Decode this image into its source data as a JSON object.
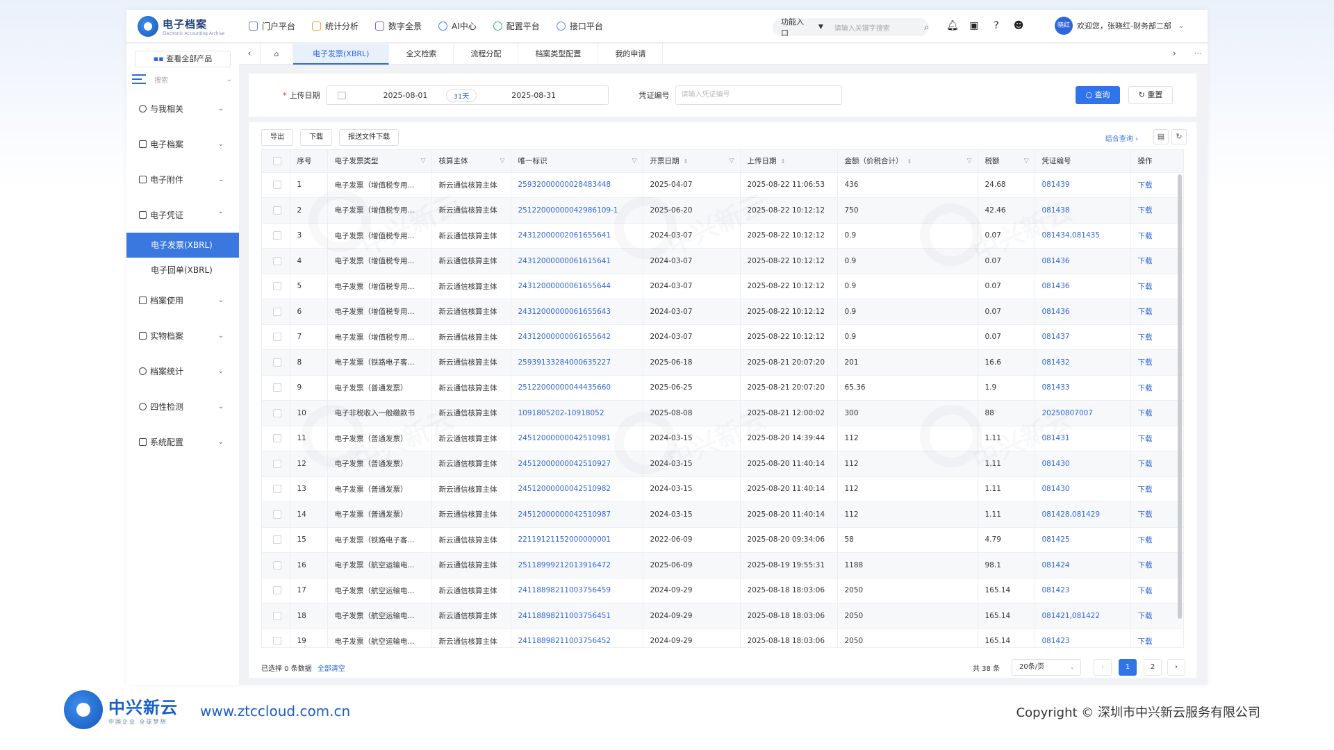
{
  "app": {
    "title": "电子档案",
    "subtitle": "Electronic Accounting Archive"
  },
  "nav": [
    "门户平台",
    "统计分析",
    "数字全景",
    "AI中心",
    "配置平台",
    "接口平台"
  ],
  "func": {
    "label": "功能入口",
    "placeholder": "请输入关键字搜索"
  },
  "user": {
    "avatar": "晓红",
    "welcome": "欢迎您，张晓红-财务部二部"
  },
  "sidebar": {
    "all_products": "查看全部产品",
    "search": "搜索",
    "items": [
      {
        "label": "与我相关"
      },
      {
        "label": "电子档案"
      },
      {
        "label": "电子附件"
      },
      {
        "label": "电子凭证"
      },
      {
        "label": "档案使用"
      },
      {
        "label": "实物档案"
      },
      {
        "label": "档案统计"
      },
      {
        "label": "四性检测"
      },
      {
        "label": "系统配置"
      }
    ],
    "subitems": [
      "电子发票(XBRL)",
      "电子回单(XBRL)"
    ]
  },
  "tabs": [
    "电子发票(XBRL)",
    "全文检索",
    "流程分配",
    "档案类型配置",
    "我的申请"
  ],
  "filter": {
    "upload_date_label": "上传日期",
    "required_mark": "*",
    "start_date": "2025-08-01",
    "days": "31天",
    "end_date": "2025-08-31",
    "voucher_label": "凭证编号",
    "voucher_placeholder": "请输入凭证编号",
    "query": "查询",
    "reset": "重置"
  },
  "toolbar": {
    "export": "导出",
    "download": "下载",
    "report_download": "报送文件下载",
    "combo_query": "结合查询"
  },
  "table": {
    "headers": [
      "序号",
      "电子发票类型",
      "核算主体",
      "唯一标识",
      "开票日期",
      "上传日期",
      "金额（价税合计）",
      "税额",
      "凭证编号",
      "操作"
    ],
    "rows": [
      [
        "1",
        "电子发票（增值税专用...",
        "新云通信核算主体",
        "25932000000028483448",
        "2025-04-07",
        "2025-08-22 11:06:53",
        "436",
        "24.68",
        "081439",
        "下载"
      ],
      [
        "2",
        "电子发票（增值税专用...",
        "新云通信核算主体",
        "25122000000042986109-1",
        "2025-06-20",
        "2025-08-22 10:12:12",
        "750",
        "42.46",
        "081438",
        "下载"
      ],
      [
        "3",
        "电子发票（增值税专用...",
        "新云通信核算主体",
        "24312000002061655641",
        "2024-03-07",
        "2025-08-22 10:12:12",
        "0.9",
        "0.07",
        "081434,081435",
        "下载"
      ],
      [
        "4",
        "电子发票（增值税专用...",
        "新云通信核算主体",
        "24312000000061615641",
        "2024-03-07",
        "2025-08-22 10:12:12",
        "0.9",
        "0.07",
        "081436",
        "下载"
      ],
      [
        "5",
        "电子发票（增值税专用...",
        "新云通信核算主体",
        "24312000000061655644",
        "2024-03-07",
        "2025-08-22 10:12:12",
        "0.9",
        "0.07",
        "081436",
        "下载"
      ],
      [
        "6",
        "电子发票（增值税专用...",
        "新云通信核算主体",
        "24312000000061655643",
        "2024-03-07",
        "2025-08-22 10:12:12",
        "0.9",
        "0.07",
        "081436",
        "下载"
      ],
      [
        "7",
        "电子发票（增值税专用...",
        "新云通信核算主体",
        "24312000000061655642",
        "2024-03-07",
        "2025-08-22 10:12:12",
        "0.9",
        "0.07",
        "081437",
        "下载"
      ],
      [
        "8",
        "电子发票（铁路电子客...",
        "新云通信核算主体",
        "25939133284000635227",
        "2025-06-18",
        "2025-08-21 20:07:20",
        "201",
        "16.6",
        "081432",
        "下载"
      ],
      [
        "9",
        "电子发票（普通发票）",
        "新云通信核算主体",
        "25122000000044435660",
        "2025-06-25",
        "2025-08-21 20:07:20",
        "65.36",
        "1.9",
        "081433",
        "下载"
      ],
      [
        "10",
        "电子非税收入一般缴款书",
        "新云通信核算主体",
        "1091805202-10918052",
        "2025-08-08",
        "2025-08-21 12:00:02",
        "300",
        "88",
        "20250807007",
        "下载"
      ],
      [
        "11",
        "电子发票（普通发票）",
        "新云通信核算主体",
        "24512000000042510981",
        "2024-03-15",
        "2025-08-20 14:39:44",
        "112",
        "1.11",
        "081431",
        "下载"
      ],
      [
        "12",
        "电子发票（普通发票）",
        "新云通信核算主体",
        "24512000000042510927",
        "2024-03-15",
        "2025-08-20 11:40:14",
        "112",
        "1.11",
        "081430",
        "下载"
      ],
      [
        "13",
        "电子发票（普通发票）",
        "新云通信核算主体",
        "24512000000042510982",
        "2024-03-15",
        "2025-08-20 11:40:14",
        "112",
        "1.11",
        "081430",
        "下载"
      ],
      [
        "14",
        "电子发票（普通发票）",
        "新云通信核算主体",
        "24512000000042510987",
        "2024-03-15",
        "2025-08-20 11:40:14",
        "112",
        "1.11",
        "081428,081429",
        "下载"
      ],
      [
        "15",
        "电子发票（铁路电子客...",
        "新云通信核算主体",
        "22119121152000000001",
        "2022-06-09",
        "2025-08-20 09:34:06",
        "58",
        "4.79",
        "081425",
        "下载"
      ],
      [
        "16",
        "电子发票（航空运输电...",
        "新云通信核算主体",
        "25118999212013916472",
        "2025-06-09",
        "2025-08-19 19:55:31",
        "1188",
        "98.1",
        "081424",
        "下载"
      ],
      [
        "17",
        "电子发票（航空运输电...",
        "新云通信核算主体",
        "24118898211003756459",
        "2024-09-29",
        "2025-08-18 18:03:06",
        "2050",
        "165.14",
        "081423",
        "下载"
      ],
      [
        "18",
        "电子发票（航空运输电...",
        "新云通信核算主体",
        "24118898211003756451",
        "2024-09-29",
        "2025-08-18 18:03:06",
        "2050",
        "165.14",
        "081421,081422",
        "下载"
      ],
      [
        "19",
        "电子发票（航空运输电...",
        "新云通信核算主体",
        "24118898211003756452",
        "2024-09-29",
        "2025-08-18 18:03:06",
        "2050",
        "165.14",
        "081423",
        "下载"
      ]
    ]
  },
  "footer": {
    "selected": "已选择 0 条数据",
    "clear_all": "全部清空",
    "total": "共 38 条",
    "page_size": "20条/页",
    "pages": [
      "1",
      "2"
    ]
  },
  "watermark": "中兴新云",
  "brand": {
    "name": "中兴新云",
    "tagline": "中国企业 全球梦想",
    "url": "www.ztccloud.com.cn",
    "copyright": "Copyright © 深圳市中兴新云服务有限公司"
  },
  "colors": {
    "primary": "#2f74eb",
    "active_menu": "#3a78e0",
    "link": "#2f66d9"
  }
}
